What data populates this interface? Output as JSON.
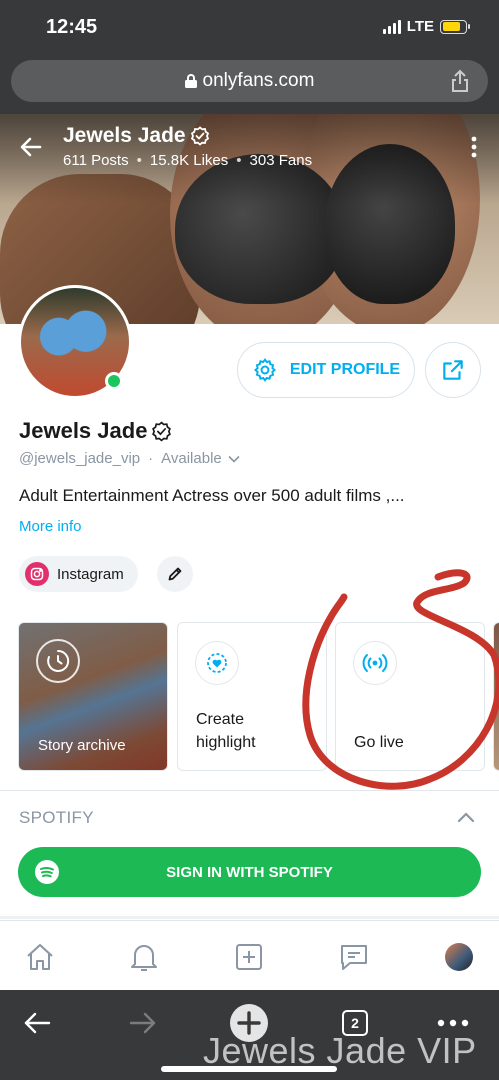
{
  "status_bar": {
    "time": "12:45",
    "network": "LTE",
    "battery_level": 0.8
  },
  "browser": {
    "url": "onlyfans.com",
    "tabs_count": "2"
  },
  "cover": {
    "name": "Jewels Jade",
    "posts": "611 Posts",
    "likes": "15.8K Likes",
    "fans": "303 Fans",
    "separator": "•"
  },
  "profile": {
    "name": "Jewels Jade",
    "handle": "@jewels_jade_vip",
    "separator": "·",
    "availability": "Available",
    "bio": "Adult Entertainment Actress over 500 adult films ,...",
    "more_info": "More info",
    "edit_profile": "EDIT PROFILE",
    "online": true
  },
  "links": {
    "instagram": "Instagram"
  },
  "highlights": {
    "story_archive": "Story archive",
    "create_line1": "Create",
    "create_line2": "highlight",
    "go_live": "Go live"
  },
  "spotify": {
    "section_title": "SPOTIFY",
    "sign_in": "SIGN IN WITH SPOTIFY"
  },
  "colors": {
    "accent": "#00aff0",
    "spotify": "#1db954",
    "online": "#1dc55f",
    "annotation": "#c8362b"
  },
  "watermark": "Jewels Jade VIP"
}
